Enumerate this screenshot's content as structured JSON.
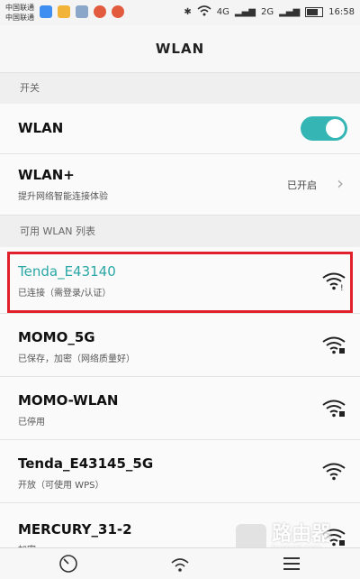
{
  "statusbar": {
    "carrier1": "中国联通",
    "carrier2": "中国联通",
    "time": "16:58",
    "net1": "4G",
    "net2": "2G"
  },
  "header": {
    "title": "WLAN"
  },
  "sections": {
    "switch_label": "开关",
    "available_label": "可用 WLAN 列表"
  },
  "wlan_row": {
    "label": "WLAN",
    "enabled": true
  },
  "wlan_plus": {
    "label": "WLAN+",
    "subtitle": "提升网络智能连接体验",
    "status": "已开启"
  },
  "networks": [
    {
      "ssid": "Tenda_E43140",
      "status": "已连接（需登录/认证）",
      "connected": true,
      "locked": false
    },
    {
      "ssid": "MOMO_5G",
      "status": "已保存，加密（网络质量好）",
      "connected": false,
      "locked": true
    },
    {
      "ssid": "MOMO-WLAN",
      "status": "已停用",
      "connected": false,
      "locked": true
    },
    {
      "ssid": "Tenda_E43145_5G",
      "status": "开放（可使用 WPS）",
      "connected": false,
      "locked": false
    },
    {
      "ssid": "MERCURY_31-2",
      "status": "加密",
      "connected": false,
      "locked": true
    }
  ],
  "colors": {
    "accent": "#35b6b5",
    "connected_text": "#2aa7a6",
    "highlight_border": "#e0202a"
  },
  "watermark": {
    "title": "路由器",
    "subtitle": "luyouqi.com"
  }
}
